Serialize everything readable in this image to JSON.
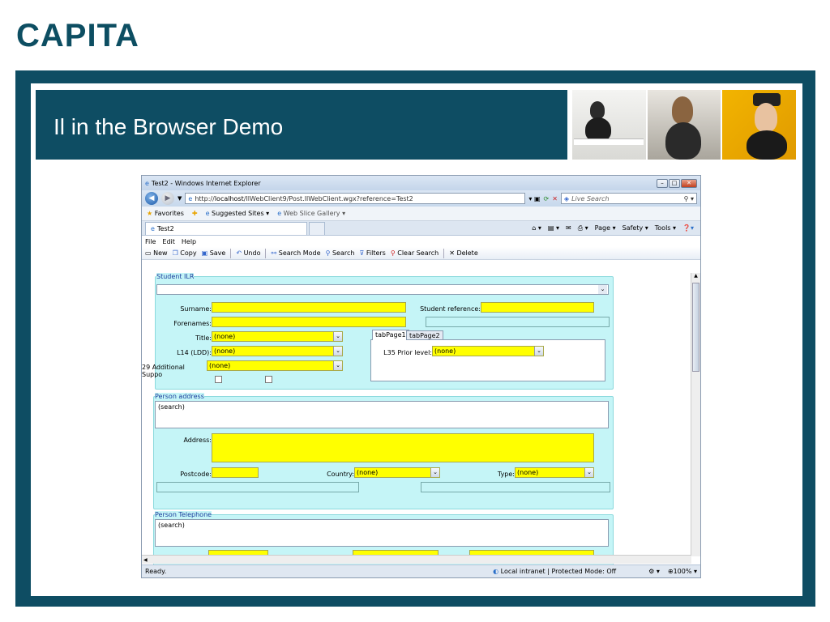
{
  "logo": "CAPITA",
  "slide_title": "Il in the Browser Demo",
  "browser": {
    "window_title": "Test2 - Windows Internet Explorer",
    "url_prefix": "http://",
    "url_host": "localhost",
    "url_path": "/IlWebClient9/Post.IlWebClient.wgx?reference=Test2",
    "search_placeholder": "Live Search",
    "favorites": "Favorites",
    "suggested_sites": "Suggested Sites ▾",
    "web_slice_gallery": "Web Slice Gallery ▾",
    "tab_title": "Test2",
    "page_menu": "Page ▾",
    "safety_menu": "Safety ▾",
    "tools_menu": "Tools ▾",
    "menu": [
      "File",
      "Edit",
      "Help"
    ],
    "toolbar": [
      "New",
      "Copy",
      "Save",
      "Undo",
      "Search Mode",
      "Search",
      "Filters",
      "Clear Search",
      "Delete"
    ],
    "status_ready": "Ready.",
    "status_zone": "Local intranet | Protected Mode: Off",
    "zoom": "100%"
  },
  "form": {
    "student_group": "Student ILR",
    "surname_label": "Surname:",
    "student_ref_label": "Student reference:",
    "forenames_label": "Forenames:",
    "title_label": "Title:",
    "title_value": "(none)",
    "l14_label": "L14 (LDD):",
    "l14_value": "(none)",
    "l29_label": "29 Additional Suppo",
    "l29_value": "(none)",
    "tab1": "tabPage1",
    "tab2": "tabPage2",
    "l35_label": "L35 Prior level:",
    "l35_value": "(none)",
    "address_group": "Person address",
    "address_search": "(search)",
    "address_label": "Address:",
    "postcode_label": "Postcode:",
    "country_label": "Country:",
    "country_value": "(none)",
    "type_label": "Type:",
    "type_value": "(none)",
    "telephone_group": "Person Telephone",
    "telephone_search": "(search)"
  },
  "colors": {
    "brand": "#0e4d63",
    "field_yellow": "#ffff00",
    "group_cyan": "#c5f5f7"
  }
}
